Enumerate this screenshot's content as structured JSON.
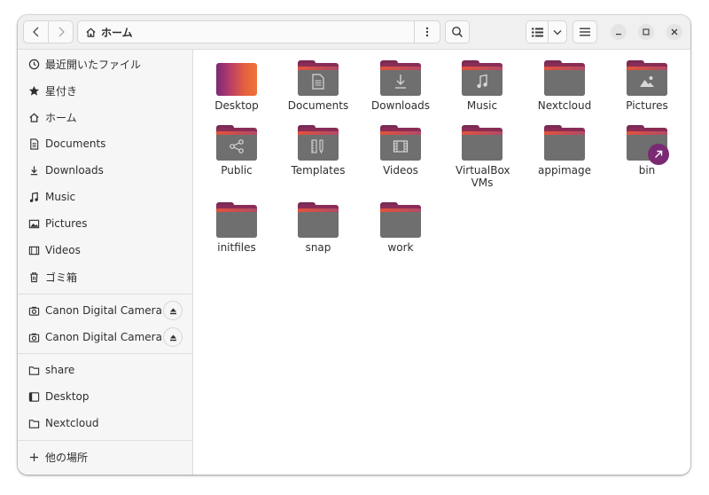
{
  "header": {
    "path_label": "ホーム"
  },
  "sidebar": {
    "places": [
      {
        "label": "最近開いたファイル",
        "icon": "clock-icon"
      },
      {
        "label": "星付き",
        "icon": "star-icon"
      },
      {
        "label": "ホーム",
        "icon": "home-icon"
      },
      {
        "label": "Documents",
        "icon": "document-icon"
      },
      {
        "label": "Downloads",
        "icon": "download-icon"
      },
      {
        "label": "Music",
        "icon": "music-icon"
      },
      {
        "label": "Pictures",
        "icon": "picture-icon"
      },
      {
        "label": "Videos",
        "icon": "video-icon"
      },
      {
        "label": "ゴミ箱",
        "icon": "trash-icon"
      }
    ],
    "devices": [
      {
        "label": "Canon Digital Camera",
        "icon": "camera-icon"
      },
      {
        "label": "Canon Digital Camera",
        "icon": "camera-icon"
      }
    ],
    "bookmarks": [
      {
        "label": "share",
        "icon": "folder-icon"
      },
      {
        "label": "Desktop",
        "icon": "desktop-icon"
      },
      {
        "label": "Nextcloud",
        "icon": "folder-icon"
      }
    ],
    "other_locations": {
      "label": "他の場所",
      "icon": "plus-icon"
    }
  },
  "files": [
    {
      "label": "Desktop",
      "emblem": "desktop-icon"
    },
    {
      "label": "Documents",
      "emblem": "document-icon"
    },
    {
      "label": "Downloads",
      "emblem": "download-icon"
    },
    {
      "label": "Music",
      "emblem": "music-icon"
    },
    {
      "label": "Nextcloud",
      "emblem": "folder-icon"
    },
    {
      "label": "Pictures",
      "emblem": "picture-icon"
    },
    {
      "label": "Public",
      "emblem": "share-icon"
    },
    {
      "label": "Templates",
      "emblem": "template-icon"
    },
    {
      "label": "Videos",
      "emblem": "video-icon"
    },
    {
      "label": "VirtualBox VMs",
      "emblem": "folder-icon"
    },
    {
      "label": "appimage",
      "emblem": "folder-icon"
    },
    {
      "label": "bin",
      "emblem": "link-icon"
    },
    {
      "label": "initfiles",
      "emblem": "folder-icon"
    },
    {
      "label": "snap",
      "emblem": "folder-icon"
    },
    {
      "label": "work",
      "emblem": "folder-icon"
    }
  ],
  "colors": {
    "accent": "#7a2a73",
    "folder_gray": "#6f6f6f",
    "folder_back": "#8a2d56",
    "folder_stripe_orange": "#e2533a"
  }
}
